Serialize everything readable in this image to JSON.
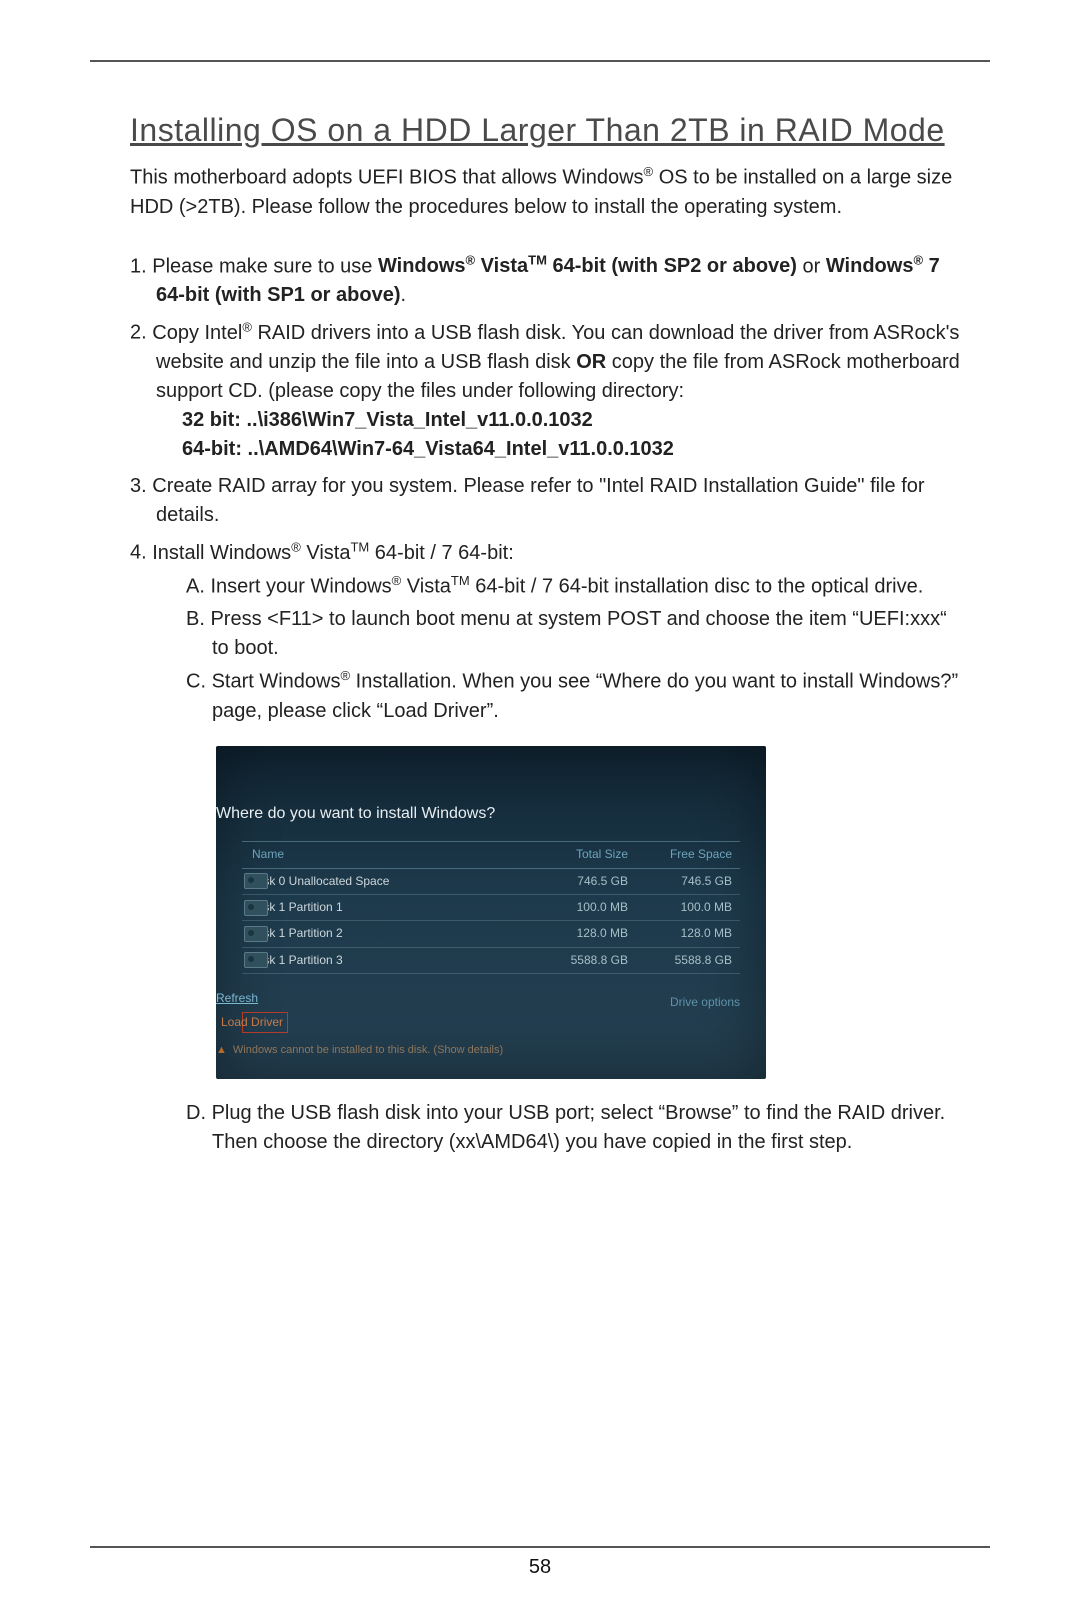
{
  "title": "Installing OS on a HDD Larger Than 2TB in RAID Mode",
  "intro_parts": {
    "a": "This motherboard adopts UEFI BIOS that allows Windows",
    "b": " OS to be installed on a large size HDD (>2TB). Please follow the procedures below to install the operating system."
  },
  "item1": {
    "num": "1.",
    "a": "Please make sure to use ",
    "b1": "Windows",
    "b2": " Vista",
    "b3": " 64-bit (with SP2 or above)",
    "c": " or ",
    "d1": "Windows",
    "d2": " 7 64-bit (with SP1 or above)",
    "e": "."
  },
  "item2": {
    "num": "2.",
    "a": "Copy Intel",
    "b": " RAID drivers into a USB flash disk. You can download the driver from ASRock's website and unzip the file into a USB flash disk ",
    "or": "OR",
    "c": " copy the file from ASRock motherboard support CD. (please copy the files under following directory:",
    "p32": "32 bit: ..\\i386\\Win7_Vista_Intel_v11.0.0.1032",
    "p64": "64-bit: ..\\AMD64\\Win7-64_Vista64_Intel_v11.0.0.1032"
  },
  "item3": {
    "num": "3.",
    "text": "Create RAID array for you system. Please refer to \"Intel RAID Installation Guide\" file for details."
  },
  "item4": {
    "num": "4.",
    "a": "Install Windows",
    "b": " Vista",
    "c": " 64-bit / 7 64-bit:",
    "A": {
      "num": "A.",
      "a": "Insert your Windows",
      "b": " Vista",
      "c": " 64-bit / 7 64-bit installation disc to the optical drive."
    },
    "B": {
      "num": "B.",
      "text": "Press <F11> to launch boot menu at system POST and choose the item “UEFI:xxx“ to boot."
    },
    "C": {
      "num": "C.",
      "a": "Start Windows",
      "b": " Installation. When you see “Where do you want to install Windows?” page, please click “Load Driver”."
    },
    "D": {
      "num": "D.",
      "text": "Plug the USB flash disk into your USB port; select “Browse” to find the RAID driver. Then choose the directory (xx\\AMD64\\) you have copied in the first step."
    }
  },
  "figure": {
    "back_arrow": "←",
    "title": "Where do you want to install Windows?",
    "columns": {
      "name": "Name",
      "total": "Total Size",
      "free": "Free Space"
    },
    "rows": [
      {
        "name": "Disk 0 Unallocated Space",
        "total": "746.5 GB",
        "free": "746.5 GB"
      },
      {
        "name": "Disk 1 Partition 1",
        "total": "100.0 MB",
        "free": "100.0 MB"
      },
      {
        "name": "Disk 1 Partition 2",
        "total": "128.0 MB",
        "free": "128.0 MB"
      },
      {
        "name": "Disk 1 Partition 3",
        "total": "5588.8 GB",
        "free": "5588.8 GB"
      }
    ],
    "refresh": "Refresh",
    "load_driver": "Load Driver",
    "drive_options": "Drive options",
    "warning": "Windows cannot be installed to this disk.  (Show details)"
  },
  "page_number": "58",
  "sup_reg": "®",
  "sup_tm": "TM"
}
